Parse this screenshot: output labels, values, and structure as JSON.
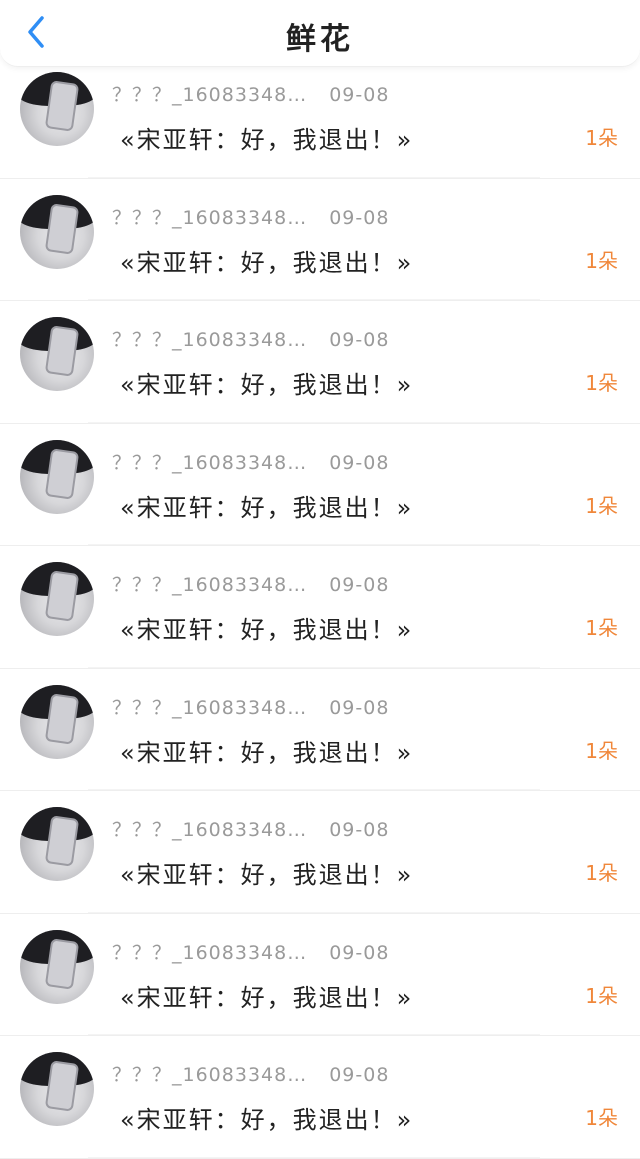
{
  "header": {
    "title": "鲜花"
  },
  "rows": [
    {
      "user": "？？？_16083348…",
      "date": "09-08",
      "message": "«宋亚轩：好，我退出！»",
      "count": "1朵"
    },
    {
      "user": "？？？_16083348…",
      "date": "09-08",
      "message": "«宋亚轩：好，我退出！»",
      "count": "1朵"
    },
    {
      "user": "？？？_16083348…",
      "date": "09-08",
      "message": "«宋亚轩：好，我退出！»",
      "count": "1朵"
    },
    {
      "user": "？？？_16083348…",
      "date": "09-08",
      "message": "«宋亚轩：好，我退出！»",
      "count": "1朵"
    },
    {
      "user": "？？？_16083348…",
      "date": "09-08",
      "message": "«宋亚轩：好，我退出！»",
      "count": "1朵"
    },
    {
      "user": "？？？_16083348…",
      "date": "09-08",
      "message": "«宋亚轩：好，我退出！»",
      "count": "1朵"
    },
    {
      "user": "？？？_16083348…",
      "date": "09-08",
      "message": "«宋亚轩：好，我退出！»",
      "count": "1朵"
    },
    {
      "user": "？？？_16083348…",
      "date": "09-08",
      "message": "«宋亚轩：好，我退出！»",
      "count": "1朵"
    },
    {
      "user": "？？？_16083348…",
      "date": "09-08",
      "message": "«宋亚轩：好，我退出！»",
      "count": "1朵"
    }
  ],
  "colors": {
    "accent_back": "#2f8ef5",
    "count": "#f0873a",
    "meta": "#9a9a9a"
  },
  "icons": {
    "back": "chevron-left-icon"
  }
}
